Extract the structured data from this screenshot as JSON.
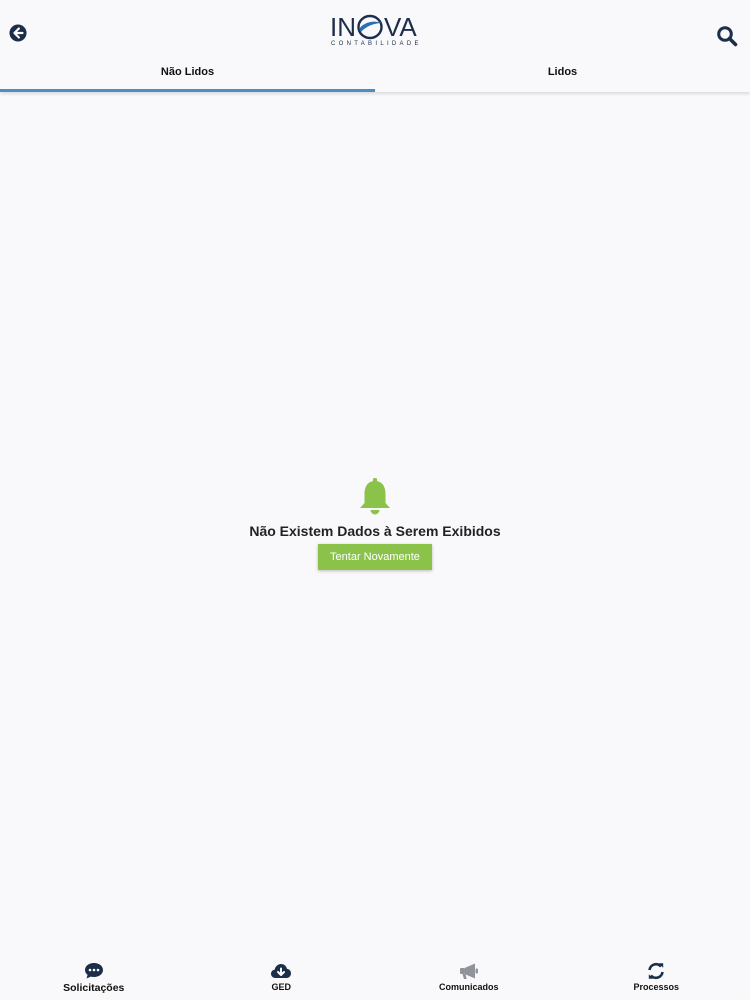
{
  "header": {
    "back_icon": "arrow-left-circle-icon",
    "search_icon": "search-icon",
    "logo": {
      "word_left": "IN",
      "word_right": "VA",
      "subtitle": "CONTABILIDADE"
    }
  },
  "tabs": [
    {
      "label": "Não Lidos",
      "active": true
    },
    {
      "label": "Lidos",
      "active": false
    }
  ],
  "empty_state": {
    "icon": "bell-icon",
    "message": "Não Existem Dados à Serem Exibidos",
    "retry_label": "Tentar Novamente"
  },
  "bottom_nav": [
    {
      "label": "Solicitações",
      "icon": "chat-bubble-icon"
    },
    {
      "label": "GED",
      "icon": "cloud-download-icon"
    },
    {
      "label": "Comunicados",
      "icon": "megaphone-icon"
    },
    {
      "label": "Processos",
      "icon": "refresh-icon"
    }
  ],
  "colors": {
    "accent": "#4a8fc4",
    "green": "#8bc34a",
    "navy": "#1c2e4a",
    "background": "#f9f9fb"
  }
}
